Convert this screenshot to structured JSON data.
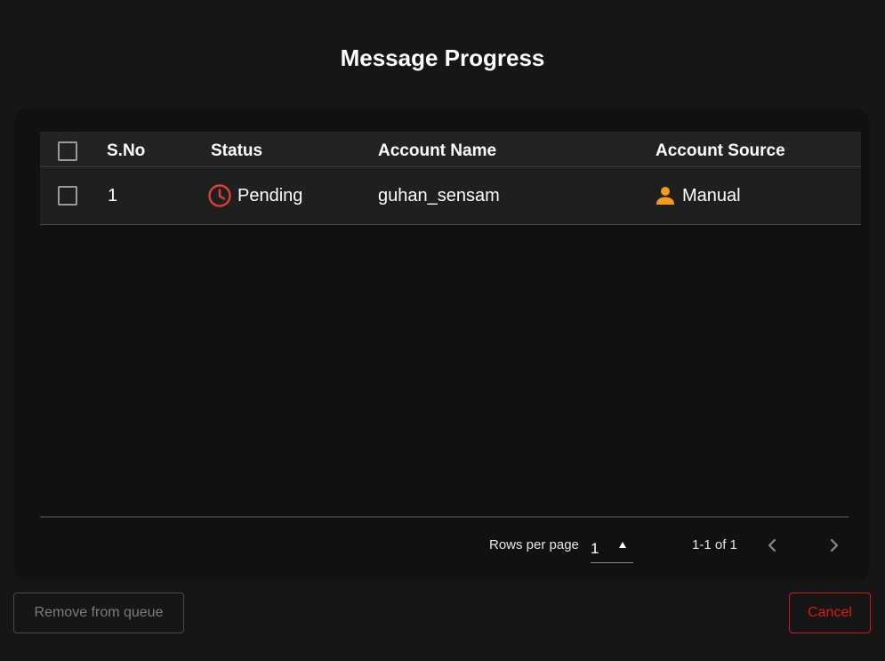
{
  "dialog": {
    "title": "Message Progress"
  },
  "table": {
    "columns": [
      "S.No",
      "Status",
      "Account Name",
      "Account Source"
    ],
    "rows": [
      {
        "sno": "1",
        "status": "Pending",
        "status_icon": "clock-icon",
        "account_name": "guhan_sensam",
        "account_source": "Manual",
        "source_icon": "person-icon"
      }
    ]
  },
  "pagination": {
    "rows_per_page_label": "Rows per page",
    "rows_per_page_value": "1",
    "range_text": "1-1 of 1"
  },
  "actions": {
    "remove_label": "Remove from queue",
    "cancel_label": "Cancel"
  },
  "colors": {
    "background": "#161616",
    "pending": "#d9403a",
    "source_icon": "#f59a1b",
    "cancel": "#e01818"
  }
}
